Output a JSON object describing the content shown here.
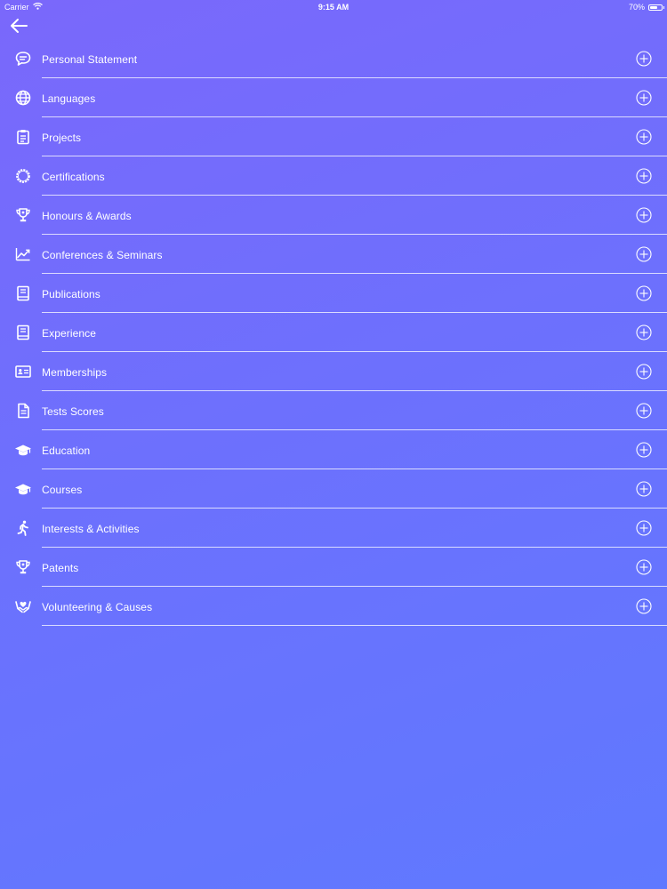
{
  "status_bar": {
    "carrier": "Carrier",
    "time": "9:15 AM",
    "battery": "70%",
    "battery_level": 0.7
  },
  "nav": {
    "back_icon": "arrow-left-icon"
  },
  "sections": [
    {
      "label": "Personal Statement",
      "icon": "chat-bubble-icon"
    },
    {
      "label": "Languages",
      "icon": "globe-icon"
    },
    {
      "label": "Projects",
      "icon": "clipboard-icon"
    },
    {
      "label": "Certifications",
      "icon": "seal-icon"
    },
    {
      "label": "Honours & Awards",
      "icon": "trophy-icon"
    },
    {
      "label": "Conferences & Seminars",
      "icon": "trending-up-icon"
    },
    {
      "label": "Publications",
      "icon": "book-icon"
    },
    {
      "label": "Experience",
      "icon": "book-icon"
    },
    {
      "label": "Memberships",
      "icon": "id-card-icon"
    },
    {
      "label": "Tests Scores",
      "icon": "document-icon"
    },
    {
      "label": "Education",
      "icon": "graduation-cap-icon"
    },
    {
      "label": "Courses",
      "icon": "graduation-cap-icon"
    },
    {
      "label": "Interests & Activities",
      "icon": "running-person-icon"
    },
    {
      "label": "Patents",
      "icon": "trophy-icon"
    },
    {
      "label": "Volunteering & Causes",
      "icon": "helping-hands-icon"
    }
  ],
  "add_icon": "plus-circle-icon",
  "colors": {
    "background_start": "#7a68fb",
    "background_end": "#5f79ff",
    "foreground": "#ffffff"
  }
}
